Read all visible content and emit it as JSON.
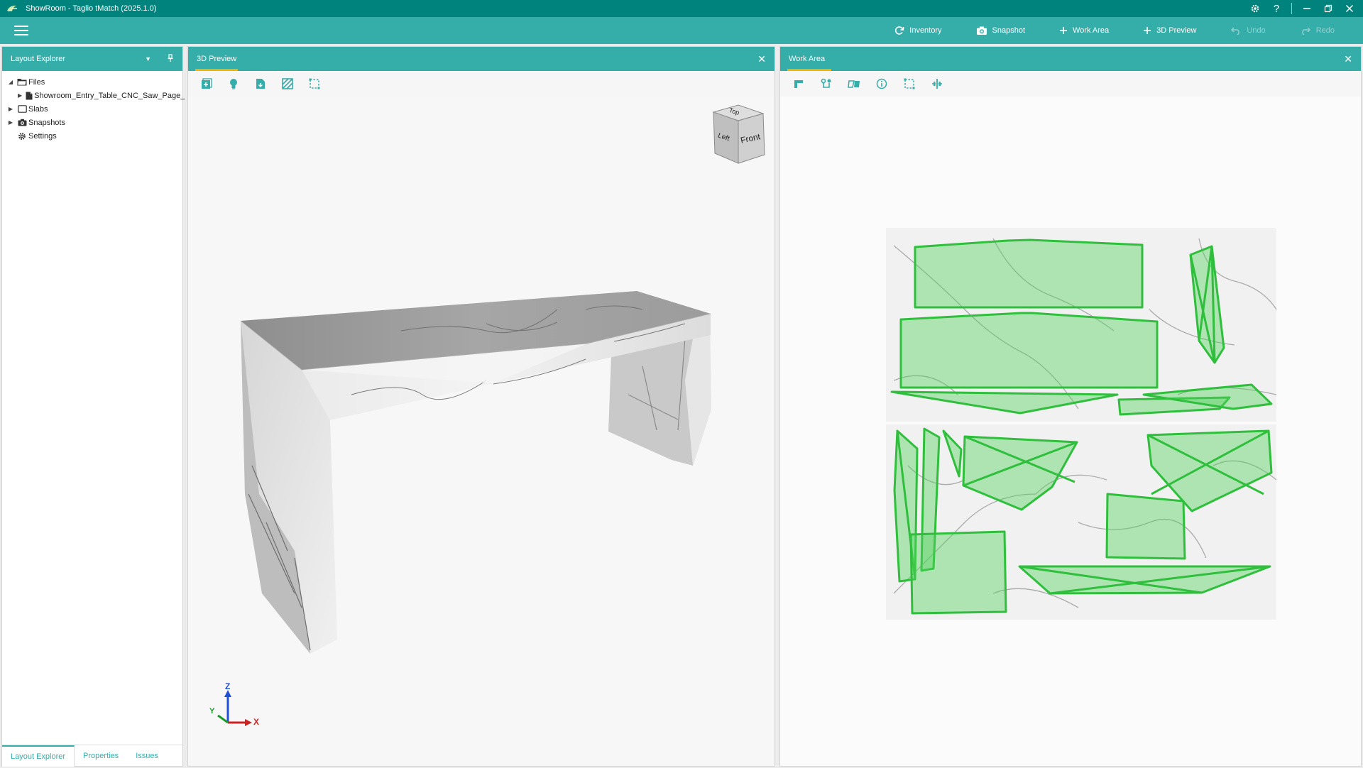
{
  "app": {
    "window_title": "ShowRoom - Taglio tMatch (2025.1.0)",
    "accent": "#00827d",
    "toolbar_color": "#35ada9"
  },
  "titlebar_icons": [
    "gear-icon",
    "help-icon",
    "minimize-icon",
    "restore-icon",
    "close-icon"
  ],
  "toolbar": {
    "actions": [
      {
        "label": "Inventory",
        "icon": "refresh-icon",
        "enabled": true
      },
      {
        "label": "Snapshot",
        "icon": "camera-icon",
        "enabled": true
      },
      {
        "label": "Work Area",
        "icon": "plus-icon",
        "enabled": true
      },
      {
        "label": "3D Preview",
        "icon": "plus-icon",
        "enabled": true
      },
      {
        "label": "Undo",
        "icon": "undo-icon",
        "enabled": false
      },
      {
        "label": "Redo",
        "icon": "redo-icon",
        "enabled": false
      }
    ]
  },
  "layout_explorer": {
    "title": "Layout Explorer",
    "tree": [
      {
        "label": "Files",
        "icon": "folder-icon",
        "expanded": true
      },
      {
        "label": "Showroom_Entry_Table_CNC_Saw_Page_",
        "icon": "file-icon",
        "expanded": false
      },
      {
        "label": "Slabs",
        "icon": "slab-icon",
        "expanded": false
      },
      {
        "label": "Snapshots",
        "icon": "camera-icon",
        "expanded": false
      },
      {
        "label": "Settings",
        "icon": "gear-icon",
        "expanded": false
      }
    ],
    "bottom_tabs": [
      "Layout Explorer",
      "Properties",
      "Issues"
    ]
  },
  "preview3d": {
    "title": "3D Preview",
    "tools": [
      "add-view-icon",
      "light-icon",
      "export-icon",
      "texture-icon",
      "selection-icon"
    ],
    "view_cube": {
      "top": "Top",
      "left": "Left",
      "front": "Front"
    },
    "axes": {
      "x": "X",
      "y": "Y",
      "z": "Z"
    }
  },
  "work_area": {
    "title": "Work Area",
    "tools": [
      "corner-icon",
      "nesting-icon",
      "flip-icon",
      "info-icon",
      "selection-icon",
      "split-icon"
    ],
    "piece_color": "#2fbf3c"
  }
}
